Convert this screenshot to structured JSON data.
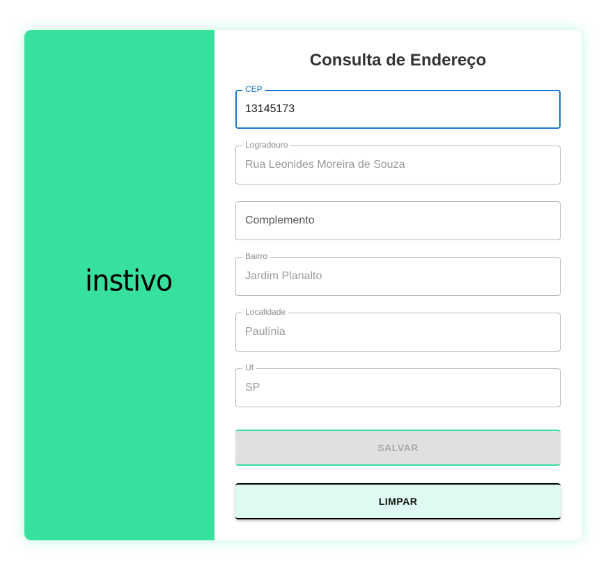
{
  "logo": "instivo",
  "title": "Consulta de Endereço",
  "fields": [
    {
      "label": "CEP",
      "value": "13145173"
    },
    {
      "label": "Logradouro",
      "value": "Rua Leonides Moreira de Souza"
    },
    {
      "label": "",
      "placeholder": "Complemento",
      "value": ""
    },
    {
      "label": "Bairro",
      "value": "Jardim Planalto"
    },
    {
      "label": "Localidade",
      "value": "Paulínia"
    },
    {
      "label": "Uf",
      "value": "SP"
    }
  ],
  "buttons": {
    "save": "SALVAR",
    "clear": "LIMPAR"
  },
  "colors": {
    "brand": "#38e09d",
    "focus": "#1976d2"
  }
}
